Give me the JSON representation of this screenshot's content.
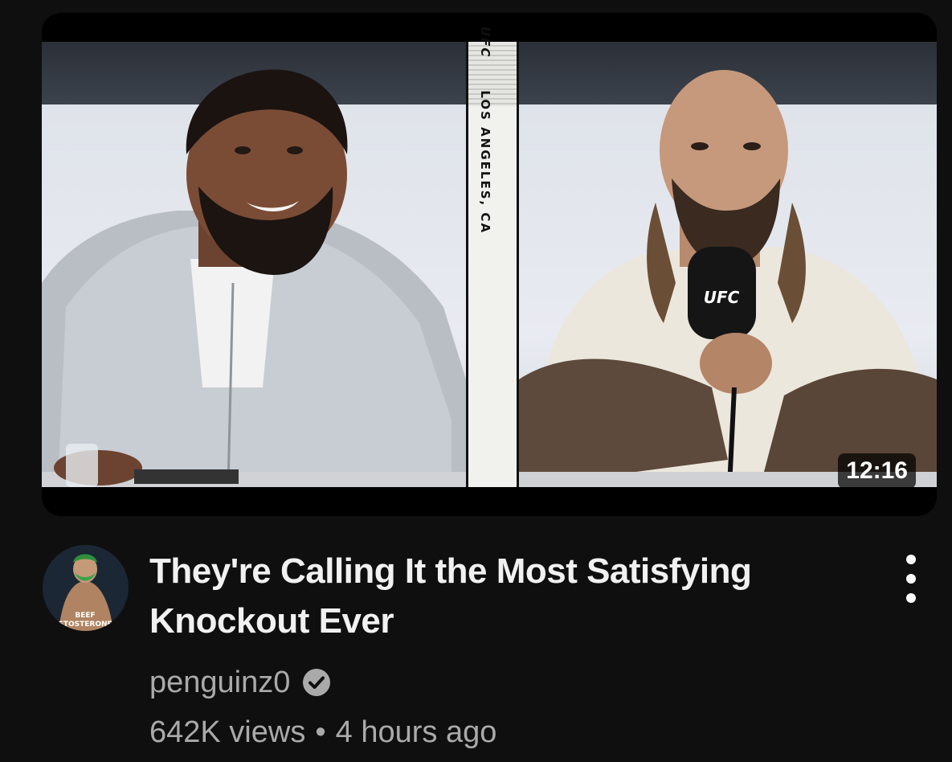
{
  "video": {
    "duration": "12:16",
    "title": "They're Calling It the Most Satisfying Knockout Ever",
    "thumbnail": {
      "divider_text": "LOS ANGELES, CA",
      "divider_brand": "UFC",
      "mic_logo": "UFC"
    }
  },
  "channel": {
    "name": "penguinz0",
    "verified": true,
    "avatar_text": "BEEF\nSTOSTERONE"
  },
  "meta": {
    "views": "642K views",
    "separator": "•",
    "age": "4 hours ago"
  },
  "icons": {
    "menu": "more-vert-icon",
    "verified": "verified-check-icon"
  },
  "colors": {
    "background": "#0f0f0f",
    "title": "#f1f1f1",
    "secondary_text": "#aaaaaa"
  }
}
